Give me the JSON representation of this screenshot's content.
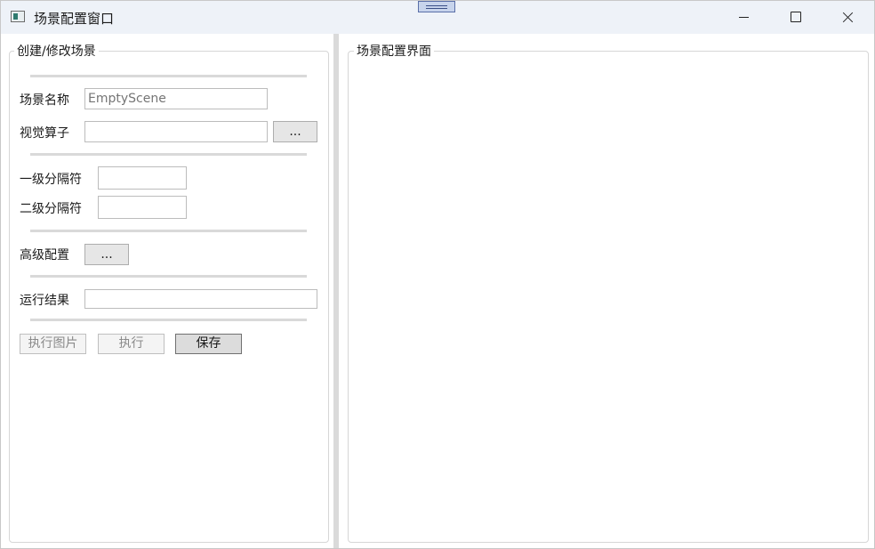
{
  "window": {
    "title": "场景配置窗口"
  },
  "left_panel": {
    "title": "创建/修改场景",
    "scene_name_label": "场景名称",
    "scene_name_placeholder": "EmptyScene",
    "scene_name_value": "",
    "vision_operator_label": "视觉算子",
    "vision_operator_value": "",
    "vision_operator_browse": "...",
    "level1_separator_label": "一级分隔符",
    "level1_separator_value": "",
    "level2_separator_label": "二级分隔符",
    "level2_separator_value": "",
    "advanced_config_label": "高级配置",
    "advanced_config_browse": "...",
    "run_result_label": "运行结果",
    "run_result_value": "",
    "buttons": {
      "execute_image": "执行图片",
      "execute": "执行",
      "save": "保存"
    }
  },
  "right_panel": {
    "title": "场景配置界面"
  }
}
